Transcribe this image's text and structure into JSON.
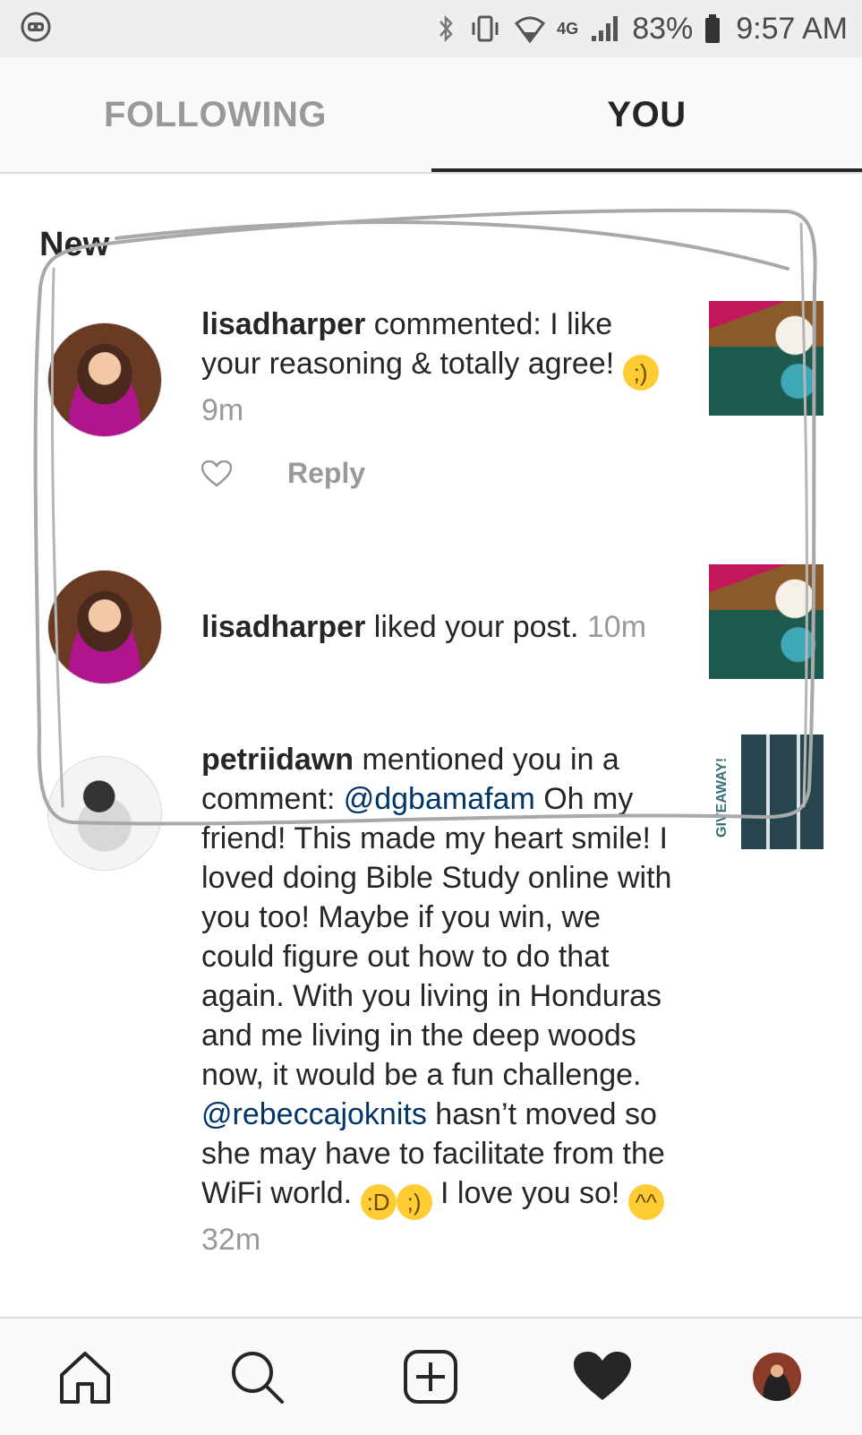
{
  "status_bar": {
    "network": "4G",
    "battery": "83%",
    "time": "9:57 AM"
  },
  "tabs": [
    {
      "label": "FOLLOWING",
      "active": false
    },
    {
      "label": "YOU",
      "active": true
    }
  ],
  "section": {
    "title": "New"
  },
  "notifications": [
    {
      "username": "lisadharper",
      "text": " commented: I like your reasoning & totally agree! ",
      "emoji": "winking-face",
      "time": "9m",
      "actions": {
        "reply": "Reply"
      }
    },
    {
      "username": "lisadharper",
      "text": " liked your post. ",
      "time": "10m"
    },
    {
      "username": "petriidawn",
      "text_a": " mentioned you in a comment: ",
      "mention_1": "@dgbamafam",
      "text_b": " Oh my friend!  This made my heart smile!  I loved doing Bible Study online with you too!  Maybe if you win, we could figure out how to do that again.  With you living in Honduras and me living in the deep woods now, it would be a fun challenge. ",
      "mention_2": "@rebeccajoknits",
      "text_c": " hasn’t moved so she may have to facilitate from the WiFi world. ",
      "emojis_1": [
        "face-with-tears-of-joy",
        "winking-face"
      ],
      "text_d": " I love you so! ",
      "emoji_end": "hugging-face",
      "time": "32m",
      "thumb_label": "GIVEAWAY!"
    }
  ],
  "colors": {
    "text": "#262626",
    "muted": "#999999",
    "mention": "#003569",
    "annotation": "#a9a9a9"
  }
}
